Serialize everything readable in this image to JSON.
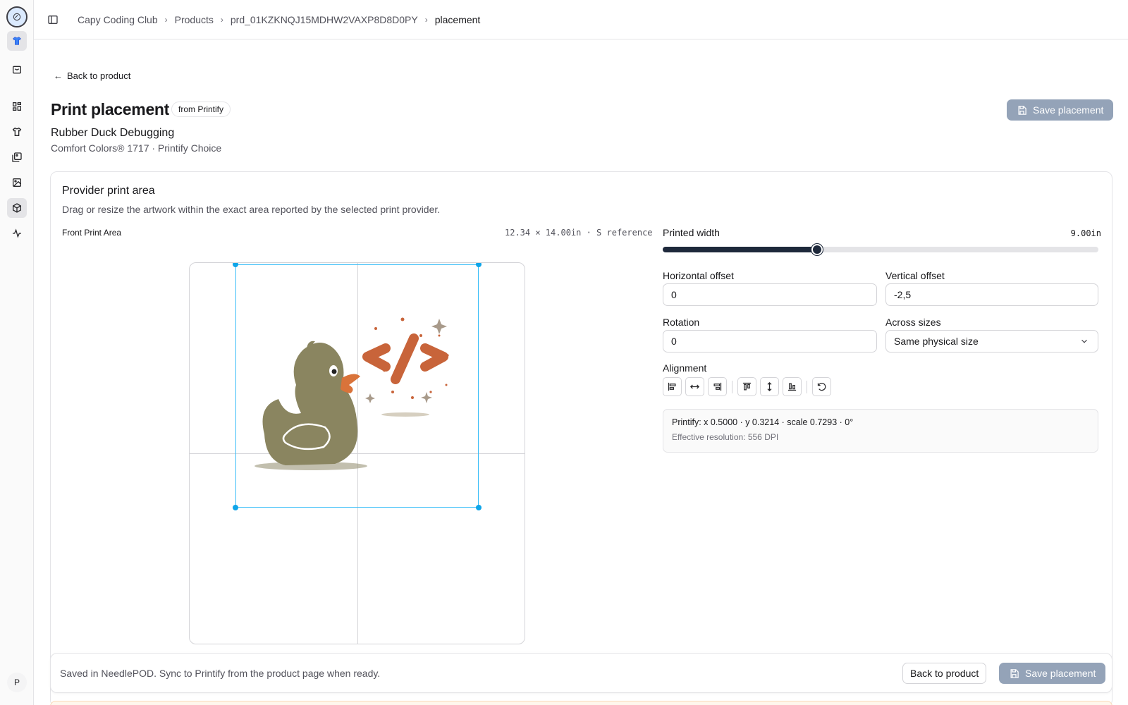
{
  "breadcrumbs": [
    "Capy Coding Club",
    "Products",
    "prd_01KZKNQJ15MDHW2VAXP8D8D0PY",
    "placement"
  ],
  "back_link": "Back to product",
  "page": {
    "title": "Print placement",
    "badge": "from Printify",
    "product_name": "Rubber Duck Debugging",
    "product_sub": "Comfort Colors® 1717 · Printify Choice",
    "save_label": "Save placement"
  },
  "card": {
    "title": "Provider print area",
    "description": "Drag or resize the artwork within the exact area reported by the selected print provider.",
    "area_label": "Front Print Area",
    "area_dims": "12.34 × 14.00in · S reference"
  },
  "controls": {
    "printed_width_label": "Printed width",
    "printed_width_value": "9.00in",
    "printed_width_fraction": 0.355,
    "horizontal_offset_label": "Horizontal offset",
    "horizontal_offset_value": "0",
    "vertical_offset_label": "Vertical offset",
    "vertical_offset_value": "-2,5",
    "rotation_label": "Rotation",
    "rotation_value": "0",
    "across_sizes_label": "Across sizes",
    "across_sizes_value": "Same physical size",
    "alignment_label": "Alignment"
  },
  "info": {
    "line": "Printify: x 0.5000 · y 0.3214 · scale 0.7293 · 0°",
    "resolution": "Effective resolution: 556 DPI"
  },
  "footer": {
    "message": "Saved in NeedlePOD. Sync to Printify from the product page when ready.",
    "back_label": "Back to product",
    "save_label": "Save placement"
  },
  "user": {
    "initial": "P"
  },
  "colors": {
    "accent": "#1e293b",
    "selection": "#38bdf8",
    "duck": "#8a8560",
    "code": "#c8643a",
    "primary_disabled": "#94a3b8"
  }
}
